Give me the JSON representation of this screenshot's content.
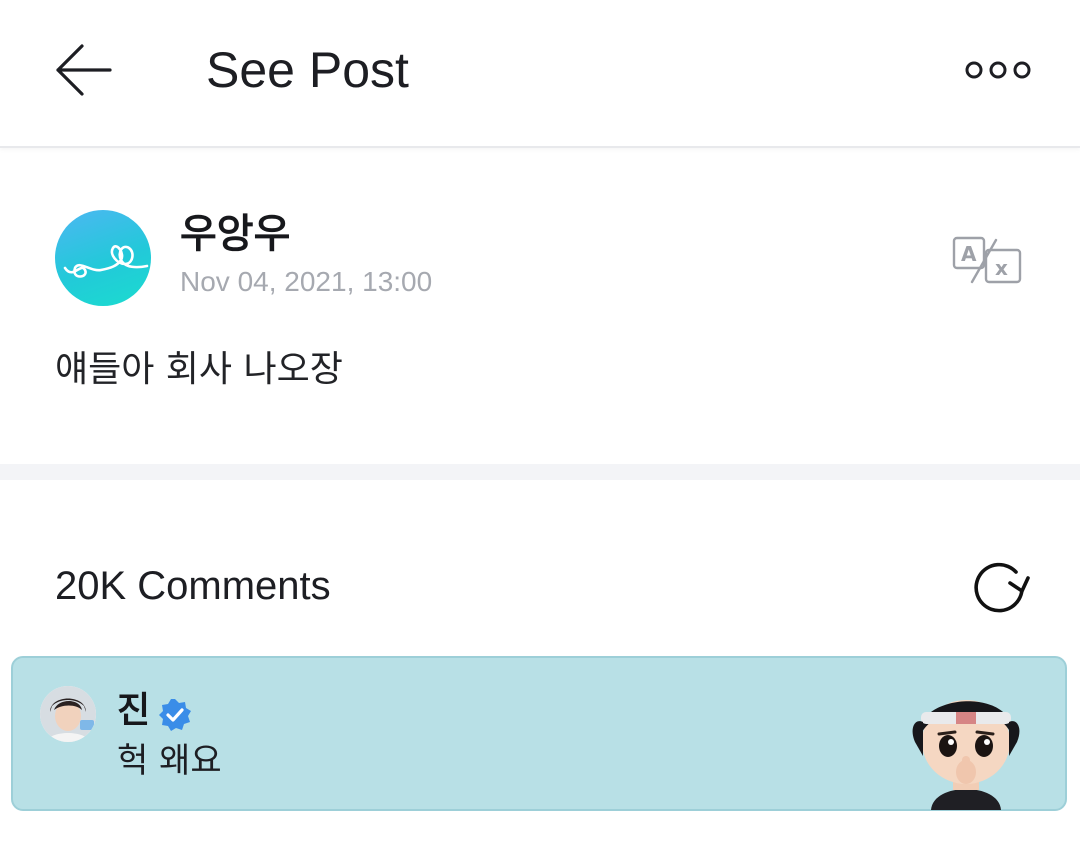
{
  "header": {
    "title": "See Post",
    "back_icon": "arrow-left-icon",
    "more_icon": "more-dots-icon"
  },
  "post": {
    "author": "우앙우",
    "date": "Nov 04, 2021, 13:00",
    "body": "얘들아 회사 나오장",
    "translate_icon": "translate-icon"
  },
  "comments": {
    "count_label": "20K Comments",
    "refresh_icon": "refresh-icon",
    "items": [
      {
        "author": "진",
        "verified": true,
        "text": "헉 왜요",
        "highlight_color": "#b8e0e6"
      }
    ]
  },
  "colors": {
    "accent_blue": "#3a8de8",
    "comment_highlight": "#b8e0e6",
    "divider": "#f3f4f7",
    "muted_text": "#a6a9b0"
  }
}
